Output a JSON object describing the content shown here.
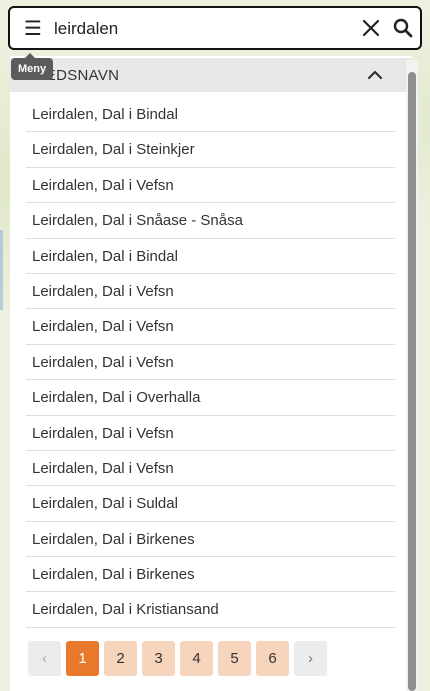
{
  "search": {
    "value": "leirdalen",
    "menu_tooltip": "Meny"
  },
  "section": {
    "title": "STEDSNAVN"
  },
  "results": [
    "Leirdalen, Dal i Bindal",
    "Leirdalen, Dal i Steinkjer",
    "Leirdalen, Dal i Vefsn",
    "Leirdalen, Dal i Snåase - Snåsa",
    "Leirdalen, Dal i Bindal",
    "Leirdalen, Dal i Vefsn",
    "Leirdalen, Dal i Vefsn",
    "Leirdalen, Dal i Vefsn",
    "Leirdalen, Dal i Overhalla",
    "Leirdalen, Dal i Vefsn",
    "Leirdalen, Dal i Vefsn",
    "Leirdalen, Dal i Suldal",
    "Leirdalen, Dal i Birkenes",
    "Leirdalen, Dal i Birkenes",
    "Leirdalen, Dal i Kristiansand"
  ],
  "pagination": {
    "prev_label": "‹",
    "next_label": "›",
    "pages": [
      "1",
      "2",
      "3",
      "4",
      "5",
      "6"
    ],
    "current": "1"
  },
  "colors": {
    "accent": "#e8792a",
    "page_bg": "#f7d5bd"
  }
}
